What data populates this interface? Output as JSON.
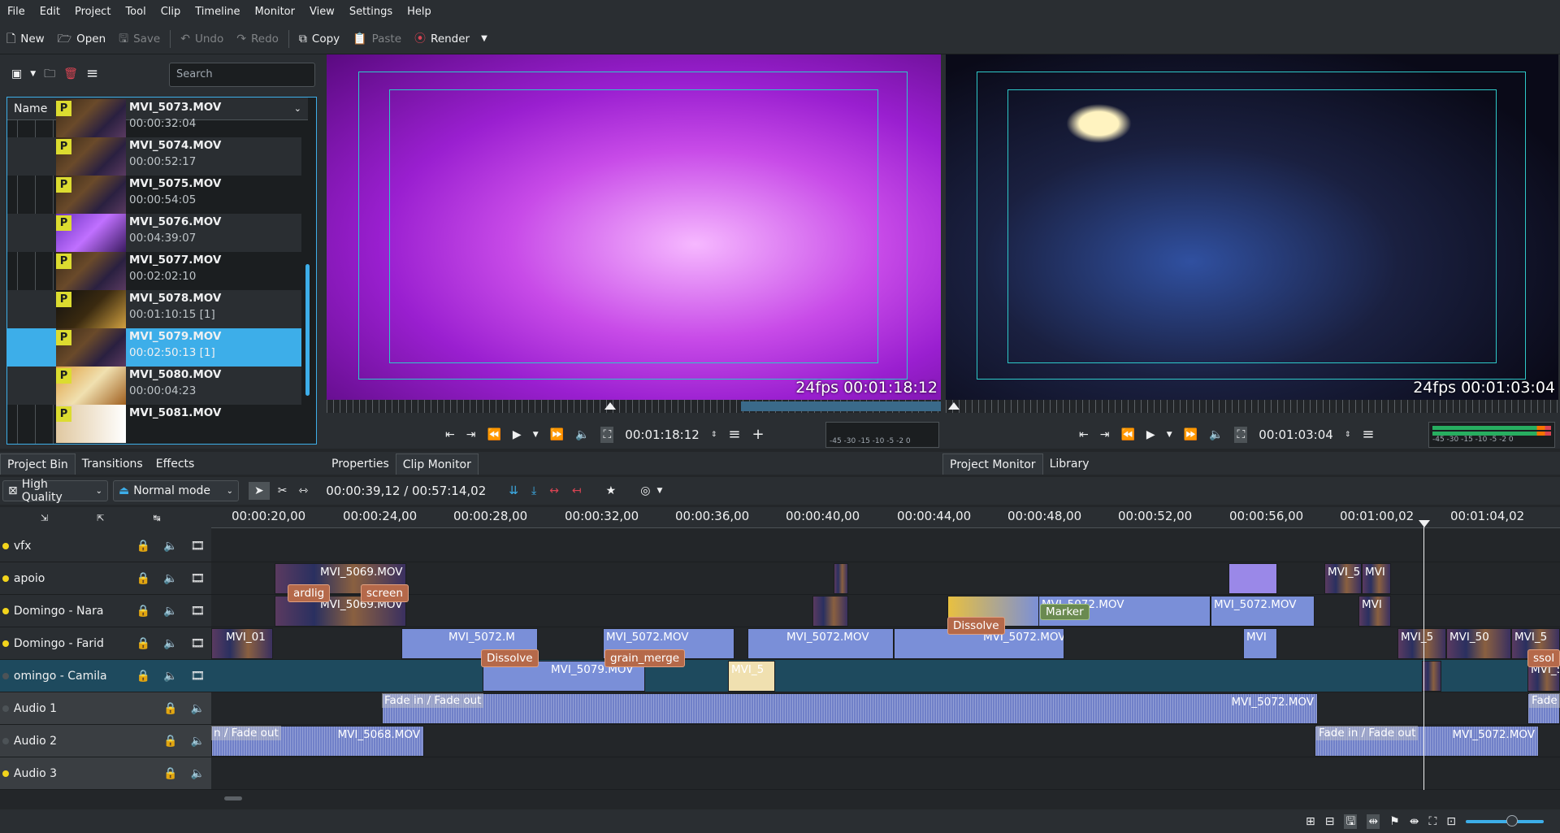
{
  "menu": [
    "File",
    "Edit",
    "Project",
    "Tool",
    "Clip",
    "Timeline",
    "Monitor",
    "View",
    "Settings",
    "Help"
  ],
  "toolbar": {
    "new_label": "New",
    "open_label": "Open",
    "save_label": "Save",
    "undo_label": "Undo",
    "redo_label": "Redo",
    "copy_label": "Copy",
    "paste_label": "Paste",
    "render_label": "Render"
  },
  "bin": {
    "search_placeholder": "Search",
    "column_header": "Name",
    "items": [
      {
        "name": "MVI_5073.MOV",
        "duration": "00:00:32:04"
      },
      {
        "name": "MVI_5074.MOV",
        "duration": "00:00:52:17"
      },
      {
        "name": "MVI_5075.MOV",
        "duration": "00:00:54:05"
      },
      {
        "name": "MVI_5076.MOV",
        "duration": "00:04:39:07"
      },
      {
        "name": "MVI_5077.MOV",
        "duration": "00:02:02:10"
      },
      {
        "name": "MVI_5078.MOV",
        "duration": "00:01:10:15  [1]"
      },
      {
        "name": "MVI_5079.MOV",
        "duration": "00:02:50:13  [1]",
        "selected": true
      },
      {
        "name": "MVI_5080.MOV",
        "duration": "00:00:04:23"
      },
      {
        "name": "MVI_5081.MOV",
        "duration": ""
      }
    ],
    "proxy_badge": "P"
  },
  "left_tabs": [
    "Project Bin",
    "Transitions",
    "Effects"
  ],
  "clip_monitor": {
    "overlay": "24fps 00:01:18:12",
    "timecode": "00:01:18:12",
    "vu_scale": "-45 -30    -15 -10   -5  -2  0"
  },
  "project_monitor": {
    "overlay": "24fps 00:01:03:04",
    "timecode": "00:01:03:04",
    "vu_scale": "-45 -30    -15 -10   -5  -2  0"
  },
  "mid_tabs": [
    "Properties",
    "Clip Monitor"
  ],
  "right_tabs": [
    "Project Monitor",
    "Library"
  ],
  "timeline_toolbar": {
    "quality": "High Quality",
    "mode": "Normal mode",
    "position": "00:00:39,12 / 00:57:14,02"
  },
  "ruler_ticks": [
    "00:00:20,00",
    "00:00:24,00",
    "00:00:28,00",
    "00:00:32,00",
    "00:00:36,00",
    "00:00:40,00",
    "00:00:44,00",
    "00:00:48,00",
    "00:00:52,00",
    "00:00:56,00",
    "00:01:00,02",
    "00:01:04,02"
  ],
  "tracks": [
    {
      "name": "vfx",
      "active": true
    },
    {
      "name": "apoio",
      "active": true
    },
    {
      "name": "Domingo - Nara",
      "active": true
    },
    {
      "name": "Domingo - Farid",
      "active": true
    },
    {
      "name": "omingo - Camila",
      "active": false
    },
    {
      "name": "Audio 1",
      "active": false
    },
    {
      "name": "Audio 2",
      "active": false
    },
    {
      "name": "Audio 3",
      "active": true
    }
  ],
  "clips": {
    "c1": "MVI_5069.MOV",
    "c2": "MVI_5069.MOV",
    "c3": "MVI_5072.MOV",
    "c4": "MVI_5072.MOV",
    "c5": "MVI_5072.M",
    "c6": "MVI_5072.MOV",
    "c7": "MVI_5072.MOV",
    "c8": "MVI_5072.MOV",
    "c9": "MVI_01",
    "c10": "MVI_5",
    "c11": "MVI_5079.MOV",
    "c12": "MVI_5072.MOV",
    "c13": "MVI_5068.MOV",
    "c14": "MVI_5072.MOV",
    "c15": "MVI_5",
    "c16": "MVI",
    "c17": "MVI",
    "c18": "MVI_5",
    "c19": "MVI_50",
    "c20": "MVI_5",
    "c21": "MVI_5",
    "c22": "MVI"
  },
  "transitions": {
    "t1": "Dissolve",
    "t2": "grain_merge",
    "t3": "Dissolve",
    "t4": "screen",
    "t5": "ardlig",
    "t6": "Marker",
    "t7": "ssol"
  },
  "fades": {
    "f1": "Fade in / Fade out",
    "f2": "n / Fade out",
    "f3": "Fade in / Fade out",
    "f4": "Fade"
  }
}
